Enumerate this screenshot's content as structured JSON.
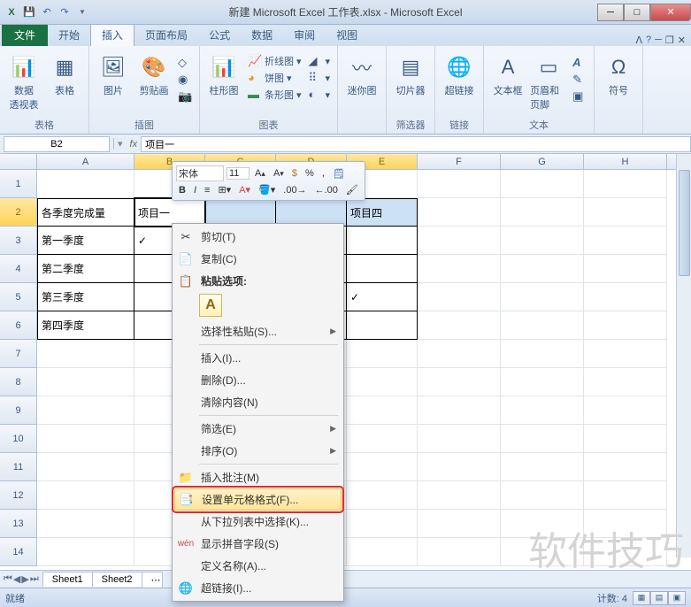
{
  "title": "新建 Microsoft Excel 工作表.xlsx - Microsoft Excel",
  "tabs": {
    "file": "文件",
    "home": "开始",
    "insert": "插入",
    "layout": "页面布局",
    "formula": "公式",
    "data": "数据",
    "review": "审阅",
    "view": "视图"
  },
  "ribbon": {
    "group_table": "表格",
    "pivot": "数据\n透视表",
    "table": "表格",
    "group_illust": "插图",
    "pic": "图片",
    "clipart": "剪贴画",
    "group_chart": "图表",
    "column": "柱形图",
    "sparkline": "折线图",
    "pie": "饼图",
    "bar": "条形图",
    "group_spark": "迷你图",
    "spark": "迷你图",
    "group_filter": "筛选器",
    "slicer": "切片器",
    "group_link": "链接",
    "hyperlink": "超链接",
    "group_text": "文本",
    "textbox": "文本框",
    "headerfooter": "页眉和页脚",
    "group_symbol": "符号",
    "symbol": "符号"
  },
  "namebox": "B2",
  "formula": "项目一",
  "mini": {
    "font": "宋体",
    "size": "11"
  },
  "columns": [
    "A",
    "B",
    "C",
    "D",
    "E",
    "F",
    "G",
    "H"
  ],
  "cells": {
    "A2": "各季度完成量",
    "B2": "项目一",
    "E2": "项目四",
    "A3": "第一季度",
    "B3": "✓",
    "A4": "第二季度",
    "A5": "第三季度",
    "E5": "✓",
    "A6": "第四季度"
  },
  "context": {
    "cut": "剪切(T)",
    "copy": "复制(C)",
    "paste_header": "粘贴选项:",
    "paste_special": "选择性粘贴(S)...",
    "insert": "插入(I)...",
    "delete": "删除(D)...",
    "clear": "清除内容(N)",
    "filter": "筛选(E)",
    "sort": "排序(O)",
    "comment": "插入批注(M)",
    "format": "设置单元格格式(F)...",
    "dropdown": "从下拉列表中选择(K)...",
    "pinyin": "显示拼音字段(S)",
    "name": "定义名称(A)...",
    "hyperlink": "超链接(I)..."
  },
  "sheets": {
    "s1": "Sheet1",
    "s2": "Sheet2"
  },
  "status": {
    "ready": "就绪",
    "count": "计数: 4"
  },
  "watermark": "软件技巧"
}
